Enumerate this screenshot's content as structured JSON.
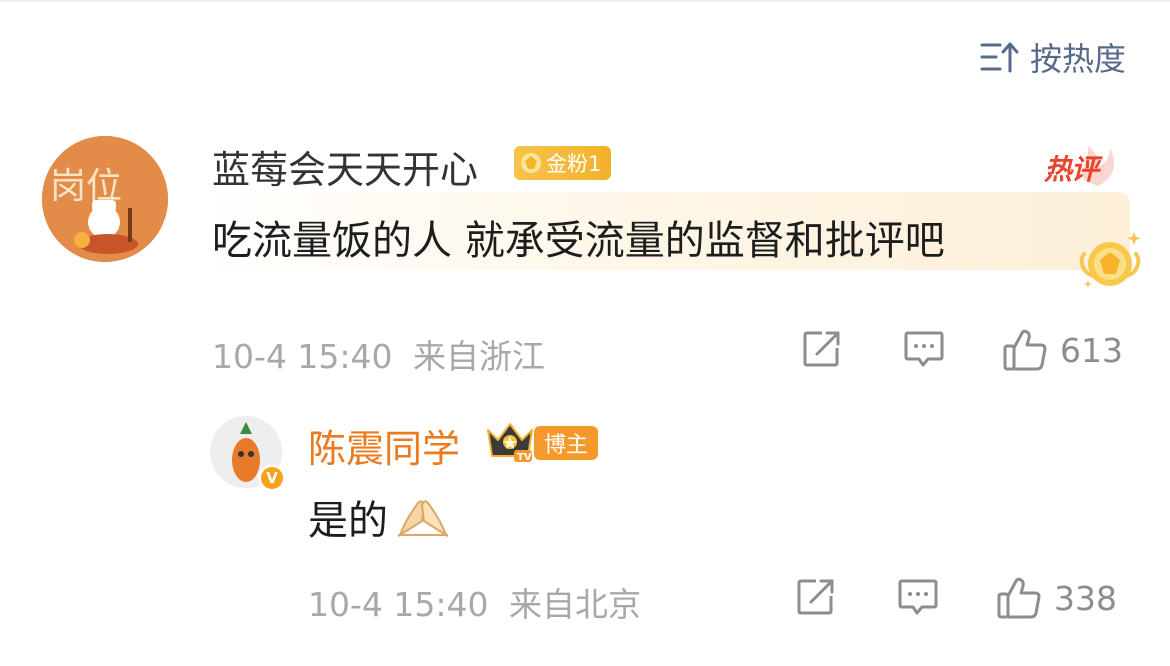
{
  "sort": {
    "icon": "sort-icon",
    "label": "按热度"
  },
  "main_comment": {
    "username": "蓝莓会天天开心",
    "fan_badge": "金粉1",
    "hot_tag": "热评",
    "text": "吃流量饭的人 就承受流量的监督和批评吧",
    "timestamp": "10-4 15:40",
    "location": "来自浙江",
    "like_count": "613",
    "avatar_text": "岗位"
  },
  "reply": {
    "username": "陈震同学",
    "badge": "博主",
    "text": "是的",
    "emoji": "🙏",
    "timestamp": "10-4 15:40",
    "location": "来自北京",
    "like_count": "338"
  },
  "colors": {
    "accent_link": "#586a8c",
    "reply_username": "#ec7a1c",
    "meta_gray": "#a8a8a8",
    "hot_red": "#e8442e",
    "fan_gold": "#f2b12c",
    "avatar_orange": "#e0813e"
  }
}
